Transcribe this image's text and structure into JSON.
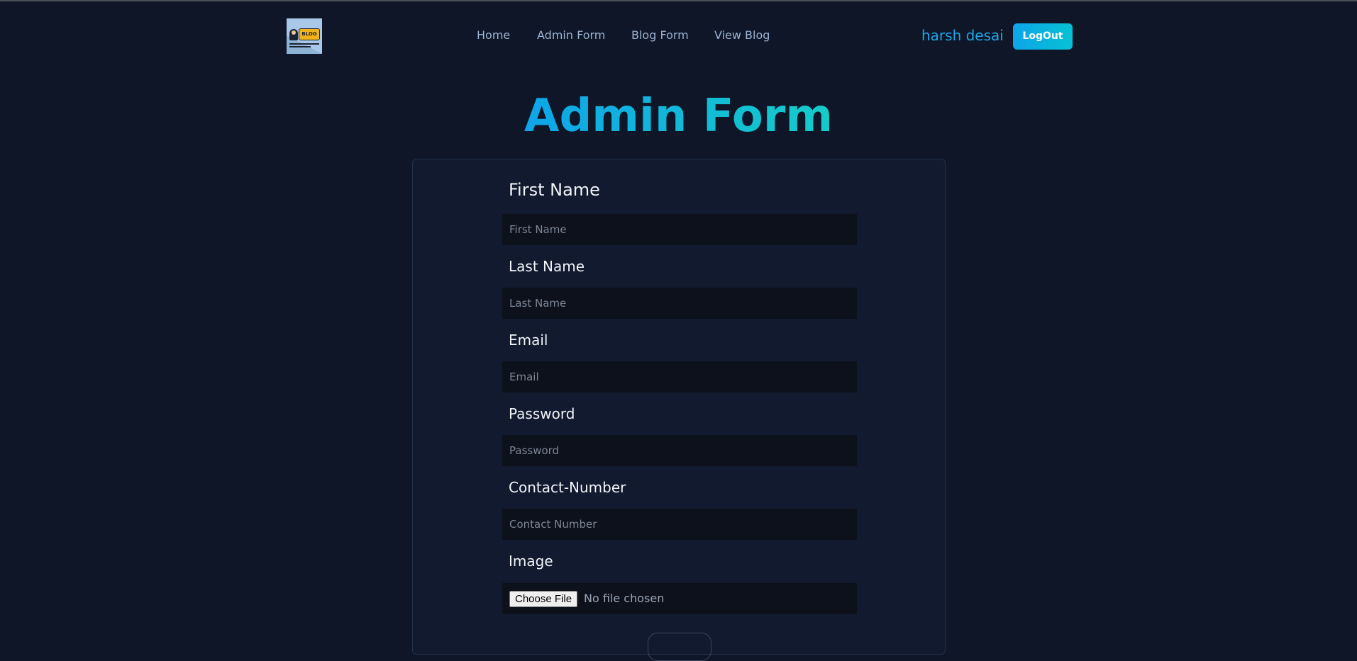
{
  "header": {
    "logo_text": "BLOG",
    "nav": [
      {
        "label": "Home"
      },
      {
        "label": "Admin Form"
      },
      {
        "label": "Blog Form"
      },
      {
        "label": "View Blog"
      }
    ],
    "username": "harsh desai",
    "logout_label": "LogOut"
  },
  "page": {
    "title": "Admin Form"
  },
  "form": {
    "first_name": {
      "label": "First Name",
      "placeholder": "First Name",
      "value": ""
    },
    "last_name": {
      "label": "Last Name",
      "placeholder": "Last Name",
      "value": ""
    },
    "email": {
      "label": "Email",
      "placeholder": "Email",
      "value": ""
    },
    "password": {
      "label": "Password",
      "placeholder": "Password",
      "value": ""
    },
    "contact": {
      "label": "Contact-Number",
      "placeholder": "Contact Number",
      "value": ""
    },
    "image": {
      "label": "Image",
      "button_label": "Choose File",
      "status": "No file chosen"
    }
  },
  "colors": {
    "background": "#0e1628",
    "card": "#111a2e",
    "accent": "#0ea5e9",
    "accent_2": "#15ccc8",
    "nav_text": "#9db3d2"
  }
}
